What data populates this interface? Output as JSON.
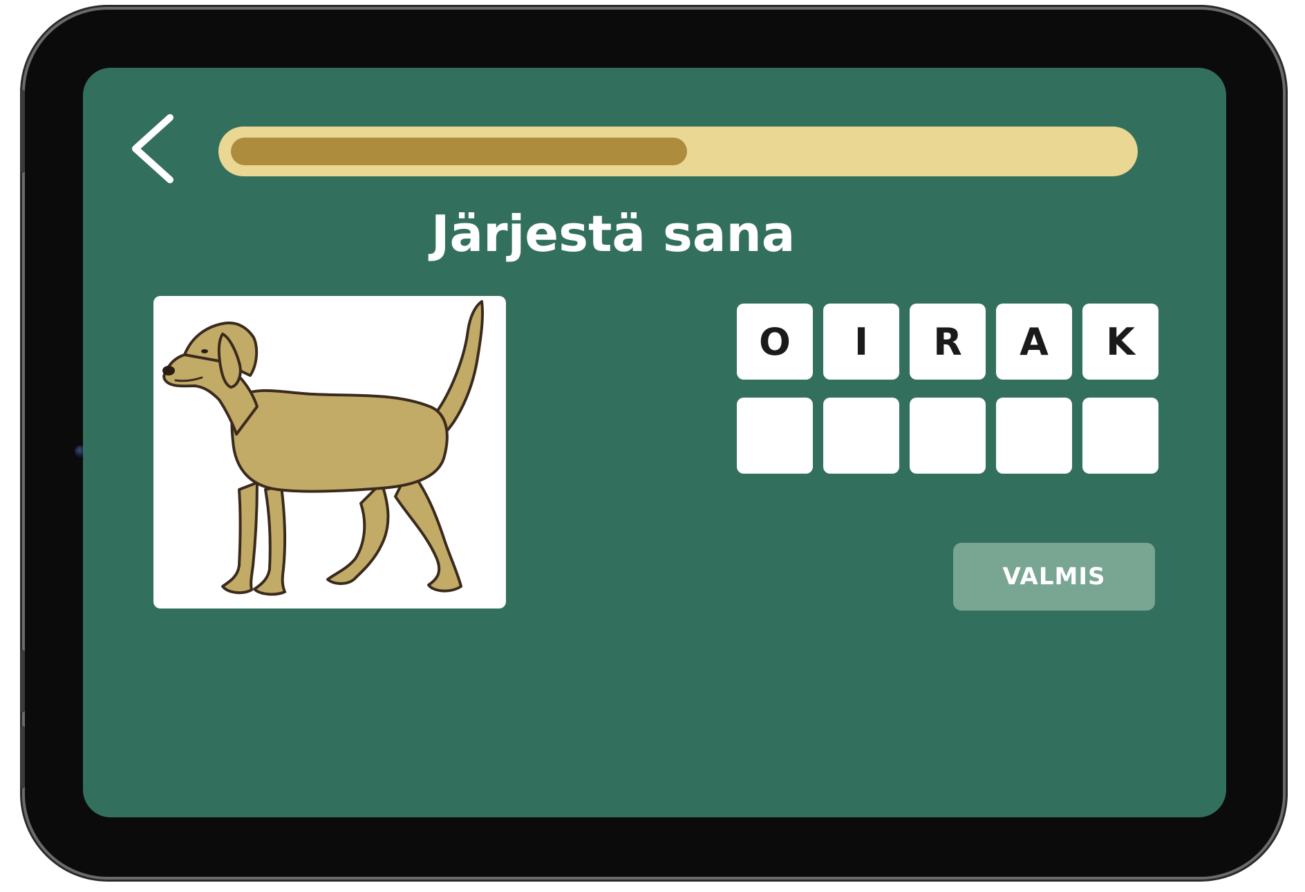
{
  "header": {
    "back_icon": "chevron-left-icon",
    "progress_fraction": 0.51
  },
  "exercise": {
    "title": "Järjestä sana",
    "image_icon": "dog-illustration",
    "letters": [
      "O",
      "I",
      "R",
      "A",
      "K"
    ],
    "answer_slots": [
      "",
      "",
      "",
      "",
      ""
    ]
  },
  "actions": {
    "done_label": "VALMIS"
  },
  "colors": {
    "background": "#336f5d",
    "progress_track": "#ebd794",
    "progress_fill": "#ad8c3e",
    "done_button": "#79a593",
    "tile": "#ffffff"
  }
}
